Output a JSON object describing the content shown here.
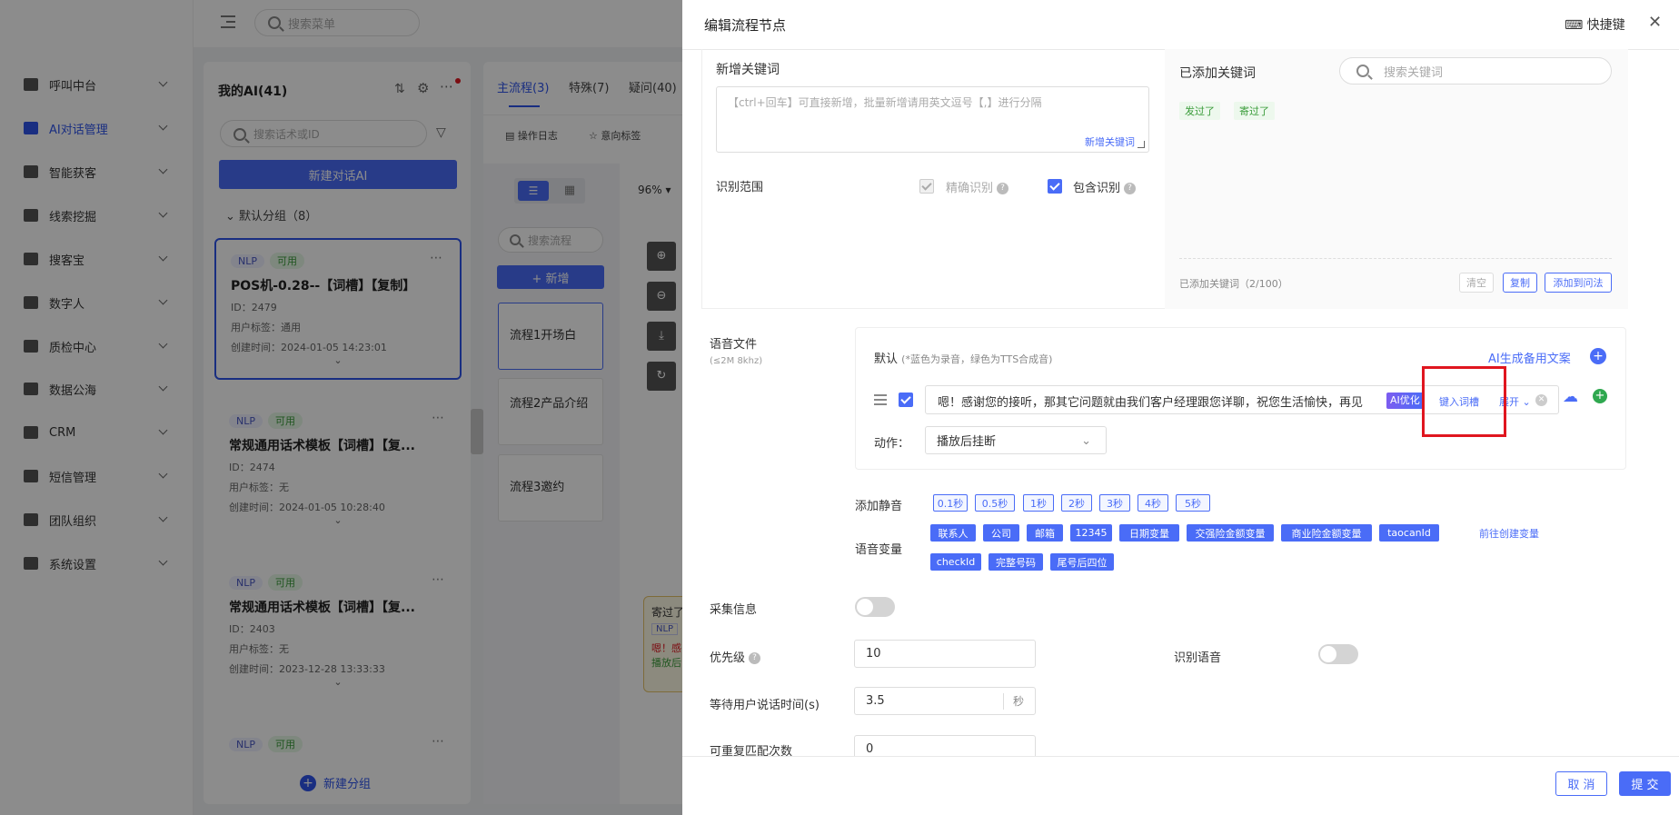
{
  "sidebar": {
    "items": [
      {
        "label": "呼叫中台"
      },
      {
        "label": "AI对话管理"
      },
      {
        "label": "智能获客"
      },
      {
        "label": "线索挖掘"
      },
      {
        "label": "搜客宝"
      },
      {
        "label": "数字人"
      },
      {
        "label": "质检中心"
      },
      {
        "label": "数据公海"
      },
      {
        "label": "CRM"
      },
      {
        "label": "短信管理"
      },
      {
        "label": "团队组织"
      },
      {
        "label": "系统设置"
      }
    ]
  },
  "topbar": {
    "search_placeholder": "搜索菜单"
  },
  "ai_list": {
    "title": "我的AI(41)",
    "search_placeholder": "搜索话术或ID",
    "new_button": "新建对话AI",
    "group_label": "默认分组（8）",
    "new_group": "新建分组",
    "cards": [
      {
        "tag1": "NLP",
        "tag2": "可用",
        "title": "POS机-0.28--【词槽】【复制】",
        "id": "ID：2479",
        "user_tag": "用户标签：通用",
        "created": "创建时间：2024-01-05 14:23:01"
      },
      {
        "tag1": "NLP",
        "tag2": "可用",
        "title": "常规通用话术模板【词槽】【复...",
        "id": "ID：2474",
        "user_tag": "用户标签：无",
        "created": "创建时间：2024-01-05 10:28:40"
      },
      {
        "tag1": "NLP",
        "tag2": "可用",
        "title": "常规通用话术模板【词槽】【复...",
        "id": "ID：2403",
        "user_tag": "用户标签：无",
        "created": "创建时间：2023-12-28 13:33:33"
      },
      {
        "tag1": "NLP",
        "tag2": "可用"
      }
    ]
  },
  "flow": {
    "tabs": [
      "主流程(3)",
      "特殊(7)",
      "疑问(40)"
    ],
    "toolbar": [
      "操作日志",
      "意向标签"
    ],
    "search_placeholder": "搜索流程",
    "add_button": "+ 新增",
    "zoom": "96%",
    "nodes": [
      "流程1开场白",
      "流程2产品介绍",
      "流程3邀约"
    ],
    "canvas_node": {
      "title": "寄过了",
      "tag": "NLP",
      "line1": "嗯！感",
      "line2": "播放后"
    }
  },
  "drawer": {
    "title": "编辑流程节点",
    "shortcut": "快捷键",
    "new_keyword_label": "新增关键词",
    "keyword_placeholder": "【ctrl+回车】可直接新增，批量新增请用英文逗号【,】进行分隔",
    "new_keyword_link": "新增关键词",
    "added_keyword_label": "已添加关键词",
    "search_keyword_placeholder": "搜索关键词",
    "added_keywords": [
      "发过了",
      "寄过了"
    ],
    "added_count": "已添加关键词（2/100）",
    "clear_btn": "清空",
    "copy_btn": "复制",
    "add_to_q_btn": "添加到问法",
    "range_label": "识别范围",
    "exact_label": "精确识别",
    "contain_label": "包含识别",
    "voice_label": "语音文件",
    "voice_sub": "(≤2M 8khz)",
    "default_label": "默认",
    "default_hint": "(*蓝色为录音，绿色为TTS合成音)",
    "ai_gen_link": "AI生成备用文案",
    "script_text": "嗯！感谢您的接听，那其它问题就由我们客户经理跟您详聊，祝您生活愉快，再见",
    "ai_opt": "AI优化",
    "insert_slot": "键入词槽",
    "expand": "展开",
    "action_label": "动作：",
    "action_value": "播放后挂断",
    "silence_label": "添加静音",
    "silence_chips": [
      "0.1秒",
      "0.5秒",
      "1秒",
      "2秒",
      "3秒",
      "4秒",
      "5秒"
    ],
    "var_label": "语音变量",
    "var_chips_row1": [
      "联系人",
      "公司",
      "邮箱",
      "12345",
      "日期变量",
      "交强险金额变量",
      "商业险金额变量",
      "taocanId"
    ],
    "var_chips_row2": [
      "checkId",
      "完整号码",
      "尾号后四位"
    ],
    "create_var_link": "前往创建变量",
    "collect_label": "采集信息",
    "priority_label": "优先级",
    "priority_value": "10",
    "recognize_voice_label": "识别语音",
    "wait_label": "等待用户说话时间(s)",
    "wait_value": "3.5",
    "wait_unit": "秒",
    "repeat_label": "可重复匹配次数",
    "repeat_value": "0",
    "cancel_btn": "取 消",
    "submit_btn": "提 交"
  },
  "colors": {
    "primary": "#4a6cf7",
    "highlight": "#e0161f",
    "nlp_tag": "#4a58c4",
    "ok_tag": "#3a9c3a"
  }
}
